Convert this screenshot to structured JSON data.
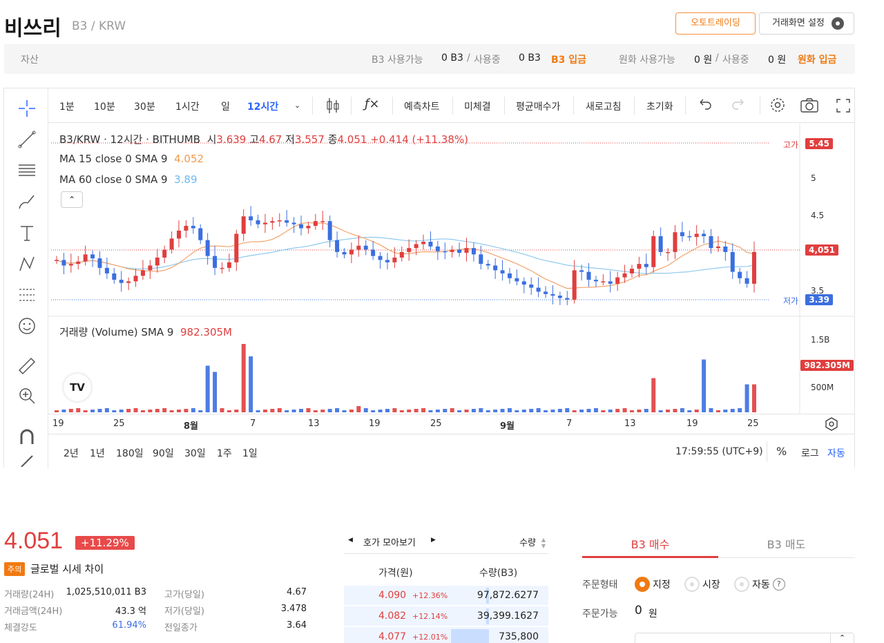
{
  "header": {
    "title": "비쓰리",
    "pair": "B3 / KRW",
    "auto_trading": "오토트레이딩",
    "screen_settings": "거래화면 설정"
  },
  "asset_bar": {
    "label": "자산",
    "b3_available_label": "B3 사용가능",
    "b3_available": "0 B3",
    "slash1": "/",
    "b3_in_use_label": "사용중",
    "b3_in_use": "0 B3",
    "b3_deposit": "B3 입금",
    "krw_available_label": "원화 사용가능",
    "krw_available": "0 원",
    "slash2": "/",
    "krw_in_use_label": "사용중",
    "krw_in_use": "0 원",
    "krw_deposit": "원화 입금"
  },
  "toolbar": {
    "intervals": [
      "1분",
      "10분",
      "30분",
      "1시간",
      "일",
      "12시간"
    ],
    "selected_interval": "12시간",
    "forecast_chart": "예측차트",
    "unfilled": "미체결",
    "avg_price": "평균매수가",
    "refresh": "새로고침",
    "reset": "초기화"
  },
  "legend": {
    "symbol": "B3/KRW · 12시간 · BITHUMB",
    "open_label": "시",
    "open": "3.639",
    "high_label": "고",
    "high": "4.67",
    "low_label": "저",
    "low": "3.557",
    "close_label": "종",
    "close": "4.051",
    "change": "+0.414 (+11.38%)",
    "ma15_label": "MA 15 close 0 SMA 9",
    "ma15_value": "4.052",
    "ma60_label": "MA 60 close 0 SMA 9",
    "ma60_value": "3.89",
    "volume_label": "거래량 (Volume) SMA 9",
    "volume_value": "982.305M"
  },
  "price_axis": {
    "ticks": [
      "5",
      "4.5",
      "3.5"
    ],
    "high_tag": "고가",
    "high_value": "5.45",
    "current_value": "4,051",
    "low_tag": "저가",
    "low_value": "3.39",
    "volume_ticks": [
      "1.5B",
      "500M"
    ],
    "volume_value": "982.305M"
  },
  "x_axis": {
    "labels": [
      "19",
      "25",
      "8월",
      "7",
      "13",
      "19",
      "25",
      "9월",
      "7",
      "13",
      "19",
      "25"
    ]
  },
  "ranges": {
    "items": [
      "2년",
      "1년",
      "180일",
      "90일",
      "30일",
      "1주",
      "1일"
    ],
    "time": "17:59:55 (UTC+9)",
    "percent": "%",
    "log": "로그",
    "auto": "자동"
  },
  "ticker": {
    "price": "4.051",
    "change_pct": "+11.29%",
    "caution": "주의",
    "global_diff": "글로벌 시세 차이",
    "stats": [
      {
        "k": "거래량(24H)",
        "v": "1,025,510,011 B3",
        "k2": "고가(당일)",
        "v2": "4.67"
      },
      {
        "k": "거래금액(24H)",
        "v": "43.3 억",
        "k2": "저가(당일)",
        "v2": "3.478"
      },
      {
        "k": "체결강도",
        "v": "61.94%",
        "k2": "전일종가",
        "v2": "3.64"
      }
    ]
  },
  "orderbook": {
    "title": "호가 모아보기",
    "sort_label": "수량",
    "price_col": "가격(원)",
    "qty_col": "수량(B3)",
    "rows": [
      {
        "price": "4.090",
        "pct": "+12.36%",
        "qty": "97,872.6277",
        "fill": 0.03
      },
      {
        "price": "4.082",
        "pct": "+12.14%",
        "qty": "39,399.1627",
        "fill": 0.03
      },
      {
        "price": "4.077",
        "pct": "+12.01%",
        "qty": "735,800",
        "fill": 0.46
      }
    ]
  },
  "trade": {
    "buy_tab": "B3 매수",
    "sell_tab": "B3 매도",
    "order_type_label": "주문형태",
    "limit": "지정",
    "market": "시장",
    "auto": "자동",
    "help": "?",
    "available_label": "주문가능",
    "available_value": "0",
    "available_unit": "원"
  },
  "colors": {
    "up": "#e03e3e",
    "down": "#3b6fe0",
    "accent": "#f07a12",
    "select_blue": "#2962ff"
  },
  "chart_data": {
    "type": "candlestick",
    "title": "B3/KRW · 12시간 · BITHUMB",
    "ylim": [
      3.3,
      5.6
    ],
    "series": [
      {
        "name": "MA 15 close 0 SMA 9",
        "value": 4.052
      },
      {
        "name": "MA 60 close 0 SMA 9",
        "value": 3.89
      },
      {
        "name": "거래량 (Volume) SMA 9",
        "value": "982.305M"
      }
    ],
    "ohlc_last": {
      "open": 3.639,
      "high": 4.67,
      "low": 3.557,
      "close": 4.051
    },
    "candles": [
      3.95,
      3.88,
      3.9,
      3.93,
      4.02,
      3.97,
      3.85,
      3.78,
      3.7,
      3.66,
      3.68,
      3.75,
      3.82,
      3.88,
      3.98,
      4.08,
      4.22,
      4.32,
      4.38,
      4.35,
      4.2,
      4.0,
      3.85,
      3.85,
      3.92,
      4.28,
      4.5,
      4.45,
      4.4,
      4.42,
      4.44,
      4.45,
      4.42,
      4.4,
      4.35,
      4.38,
      4.44,
      4.44,
      4.2,
      4.05,
      4.02,
      4.08,
      4.13,
      4.08,
      4.0,
      3.95,
      3.92,
      3.98,
      4.05,
      4.1,
      4.15,
      4.18,
      4.12,
      4.06,
      4.05,
      4.08,
      4.04,
      4.1,
      4.02,
      3.9,
      3.88,
      3.82,
      3.78,
      3.72,
      3.68,
      3.64,
      3.6,
      3.55,
      3.52,
      3.5,
      3.47,
      3.45,
      3.82,
      3.8,
      3.7,
      3.68,
      3.68,
      3.65,
      3.73,
      3.78,
      3.84,
      3.9,
      3.86,
      4.25,
      4.05,
      4.05,
      4.3,
      4.25,
      4.24,
      4.28,
      4.25,
      4.1,
      4.12,
      4.05,
      3.8,
      3.72,
      3.65,
      4.051
    ]
  }
}
